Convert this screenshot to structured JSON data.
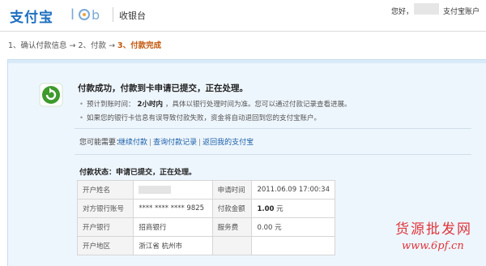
{
  "header": {
    "logo_text": "支付宝",
    "cashier_label": "收银台",
    "greeting": "您好，",
    "account_link": "支付宝账户"
  },
  "steps": [
    {
      "label": "1、确认付款信息",
      "active": false
    },
    {
      "label": "2、付款",
      "active": false
    },
    {
      "label": "3、付款完成",
      "active": true
    }
  ],
  "step_arrow": "→",
  "result": {
    "title": "付款成功，付款到卡申请已提交，正在处理。",
    "bullet1_prefix": "预计到账时间：",
    "bullet1_time": "2小时内",
    "bullet1_suffix": "，具体以银行处理时间为准。您可以通过付款记录查看进展。",
    "bullet2": "如果您的银行卡信息有误导致付款失败，资金将自动退回到您的支付宝账户。"
  },
  "actions": {
    "label": "您可能需要：",
    "continue_pay": "继续付款",
    "query_records": "查询付款记录",
    "return_account": "返回我的支付宝",
    "separator": "|"
  },
  "status": {
    "text": "付款状态：申请已提交，正在处理。"
  },
  "table": {
    "account_name_label": "开户姓名",
    "apply_time_label": "申请时间",
    "apply_time_value": "2011.06.09 17:00:34",
    "bank_account_label": "对方银行账号",
    "bank_account_value": "**** **** **** 9825",
    "amount_label": "付款金额",
    "amount_value": "1.00",
    "amount_unit": "元",
    "bank_label": "开户银行",
    "bank_value": "招商银行",
    "fee_label": "服务费",
    "fee_value": "0.00 元",
    "region_label": "开户地区",
    "region_value": "浙江省 杭州市"
  },
  "watermark": {
    "text": "货源批发网",
    "url": "www.6pf.cn"
  },
  "colors": {
    "brand_blue": "#1d6fbf",
    "active_step": "#c3570c",
    "panel_bg": "#eef6fd",
    "link": "#1a5fa8",
    "success_green": "#3d9a2b",
    "watermark_red": "#e0343a"
  }
}
